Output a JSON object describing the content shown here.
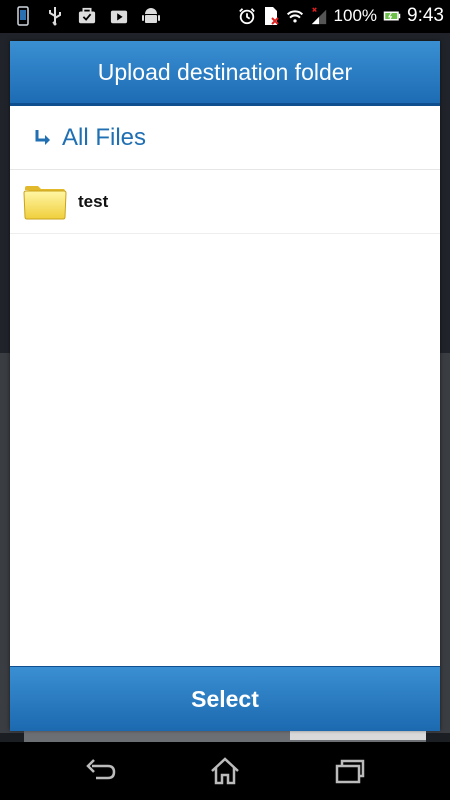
{
  "status_bar": {
    "battery_percent": "100%",
    "time": "9:43",
    "icons": [
      "phone-icon",
      "usb-icon",
      "briefcase-check-icon",
      "media-icon",
      "android-icon",
      "alarm-icon",
      "sim-error-icon",
      "wifi-icon",
      "signal-icon",
      "battery-icon"
    ]
  },
  "dialog": {
    "title": "Upload destination folder",
    "breadcrumb": {
      "label": "All Files",
      "icon": "arrow-turn-icon"
    },
    "folders": [
      {
        "name": "test",
        "icon": "folder-icon"
      }
    ],
    "select_label": "Select"
  },
  "nav_bar": {
    "buttons": [
      "back-icon",
      "home-icon",
      "recent-apps-icon"
    ]
  },
  "colors": {
    "accent": "#1f6fb2",
    "header_top": "#3a8fd2",
    "header_bottom": "#1d6cb4"
  }
}
